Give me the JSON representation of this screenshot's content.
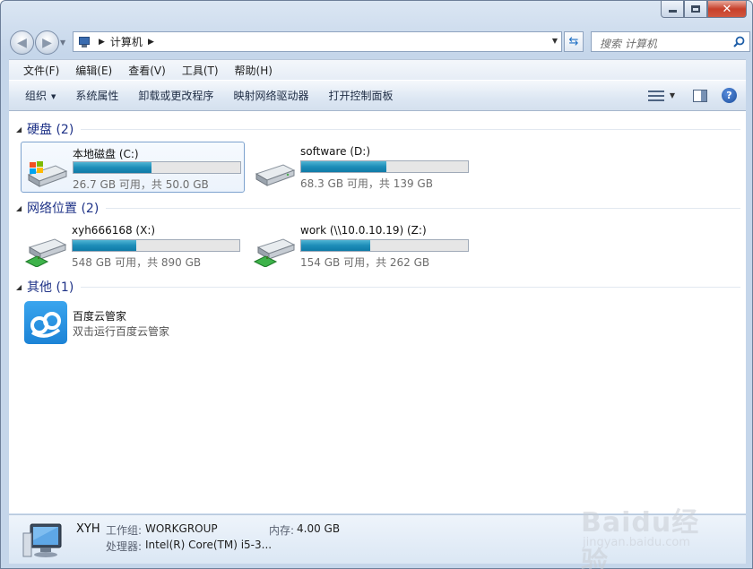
{
  "window": {
    "caption_buttons": [
      "minimize",
      "maximize",
      "close"
    ]
  },
  "address": {
    "crumb": "计算机",
    "search_placeholder": "搜索 计算机"
  },
  "menu": [
    "文件(F)",
    "编辑(E)",
    "查看(V)",
    "工具(T)",
    "帮助(H)"
  ],
  "toolbar": {
    "organize": "组织",
    "items": [
      "系统属性",
      "卸载或更改程序",
      "映射网络驱动器",
      "打开控制面板"
    ]
  },
  "groups": {
    "hard_disks": {
      "title": "硬盘 (2)",
      "drives": [
        {
          "name": "本地磁盘 (C:)",
          "usage": "26.7 GB 可用，共 50.0 GB",
          "used_fraction": 0.466,
          "icon": "windows-drive-icon"
        },
        {
          "name": "software (D:)",
          "usage": "68.3 GB 可用，共 139 GB",
          "used_fraction": 0.509,
          "icon": "hard-drive-icon"
        }
      ]
    },
    "network": {
      "title": "网络位置 (2)",
      "drives": [
        {
          "name": "xyh666168 (X:)",
          "usage": "548 GB 可用，共 890 GB",
          "used_fraction": 0.384,
          "icon": "network-drive-icon"
        },
        {
          "name": "work (\\\\10.0.10.19) (Z:)",
          "usage": "154 GB 可用，共 262 GB",
          "used_fraction": 0.412,
          "icon": "network-drive-icon"
        }
      ]
    },
    "other": {
      "title": "其他 (1)",
      "app": {
        "name": "百度云管家",
        "sub": "双击运行百度云管家"
      }
    }
  },
  "details": {
    "computer_name": "XYH",
    "workgroup_label": "工作组:",
    "workgroup_value": "WORKGROUP",
    "memory_label": "内存:",
    "memory_value": "4.00 GB",
    "processor_label": "处理器:",
    "processor_value": "Intel(R) Core(TM) i5-3..."
  },
  "watermark": {
    "text": "Baidu经验",
    "sub": "jingyan.baidu.com"
  },
  "colors": {
    "group_title": "#1e3287",
    "bar_fill": "#1d8db8",
    "selection_border": "#7da2ce"
  }
}
